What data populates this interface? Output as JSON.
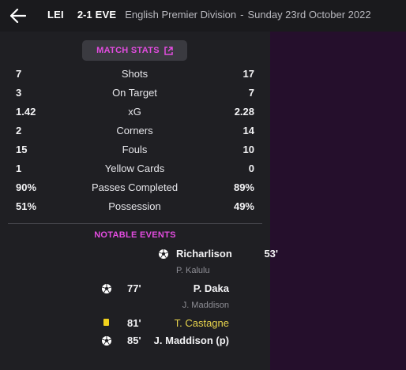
{
  "header": {
    "home": "LEI",
    "score": "2-1",
    "away": "EVE",
    "competition": "English Premier Division",
    "separator": "-",
    "date": "Sunday 23rd October 2022"
  },
  "match_stats_button": "MATCH STATS",
  "stats": [
    {
      "label": "Shots",
      "home": "7",
      "away": "17"
    },
    {
      "label": "On Target",
      "home": "3",
      "away": "7"
    },
    {
      "label": "xG",
      "home": "1.42",
      "away": "2.28"
    },
    {
      "label": "Corners",
      "home": "2",
      "away": "14"
    },
    {
      "label": "Fouls",
      "home": "15",
      "away": "10"
    },
    {
      "label": "Yellow Cards",
      "home": "1",
      "away": "0"
    },
    {
      "label": "Passes Completed",
      "home": "90%",
      "away": "89%"
    },
    {
      "label": "Possession",
      "home": "51%",
      "away": "49%"
    }
  ],
  "notable_title": "NOTABLE EVENTS",
  "events": {
    "e1": {
      "minute": "53'",
      "player": "Richarlison",
      "assist": "P. Kalulu",
      "icon": "football-icon"
    },
    "e2": {
      "minute": "77'",
      "player": "P. Daka",
      "assist": "J. Maddison",
      "icon": "football-icon"
    },
    "e3": {
      "minute": "81'",
      "player": "T. Castagne",
      "icon": "yellow-card-icon"
    },
    "e4": {
      "minute": "85'",
      "player": "J. Maddison (p)",
      "icon": "football-icon"
    }
  },
  "colors": {
    "accent": "#e34ce0",
    "yellow_card": "#f2d21c",
    "right_pane": "#250f2c"
  }
}
